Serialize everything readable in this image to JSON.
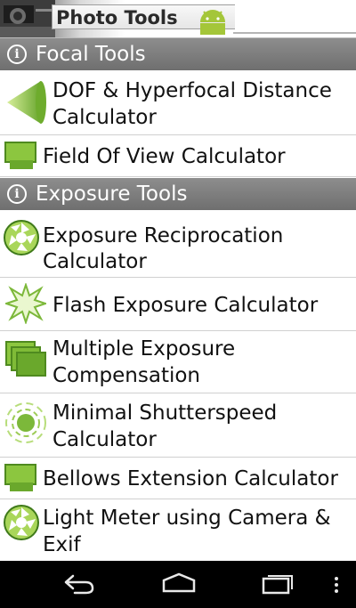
{
  "app": {
    "title": "Photo Tools"
  },
  "sections": {
    "focal": {
      "label": "Focal Tools",
      "info_icon": "info-icon"
    },
    "exposure": {
      "label": "Exposure Tools",
      "info_icon": "info-icon"
    }
  },
  "items": {
    "dof": {
      "label_line1": "DOF & Hyperfocal Distance",
      "label_line2": "Calculator",
      "icon": "dof-cone-icon"
    },
    "fov": {
      "label": "Field Of View Calculator",
      "icon": "field-of-view-icon"
    },
    "reciprocation": {
      "label_line1": "Exposure Reciprocation",
      "label_line2": "Calculator",
      "icon": "aperture-icon"
    },
    "flash": {
      "label": "Flash Exposure Calculator",
      "icon": "flash-burst-icon"
    },
    "multiple": {
      "label_line1": "Multiple Exposure",
      "label_line2": "Compensation",
      "icon": "stacked-frames-icon"
    },
    "shutter": {
      "label_line1": "Minimal Shutterspeed",
      "label_line2": "Calculator",
      "icon": "shutter-motion-icon"
    },
    "bellows": {
      "label": "Bellows Extension Calculator",
      "icon": "bellows-icon"
    },
    "lightmeter": {
      "label_line1": "Light Meter using Camera &",
      "label_line2": "Exif",
      "icon": "light-meter-aperture-icon"
    }
  },
  "navbar": {
    "back": "back-icon",
    "home": "home-icon",
    "recents": "recent-apps-icon",
    "menu": "overflow-menu-icon"
  },
  "colors": {
    "accent_green": "#8cc63f",
    "dark_green": "#3f7a1a",
    "section_grey": "#7d7d7d",
    "android_green": "#a4c639"
  }
}
